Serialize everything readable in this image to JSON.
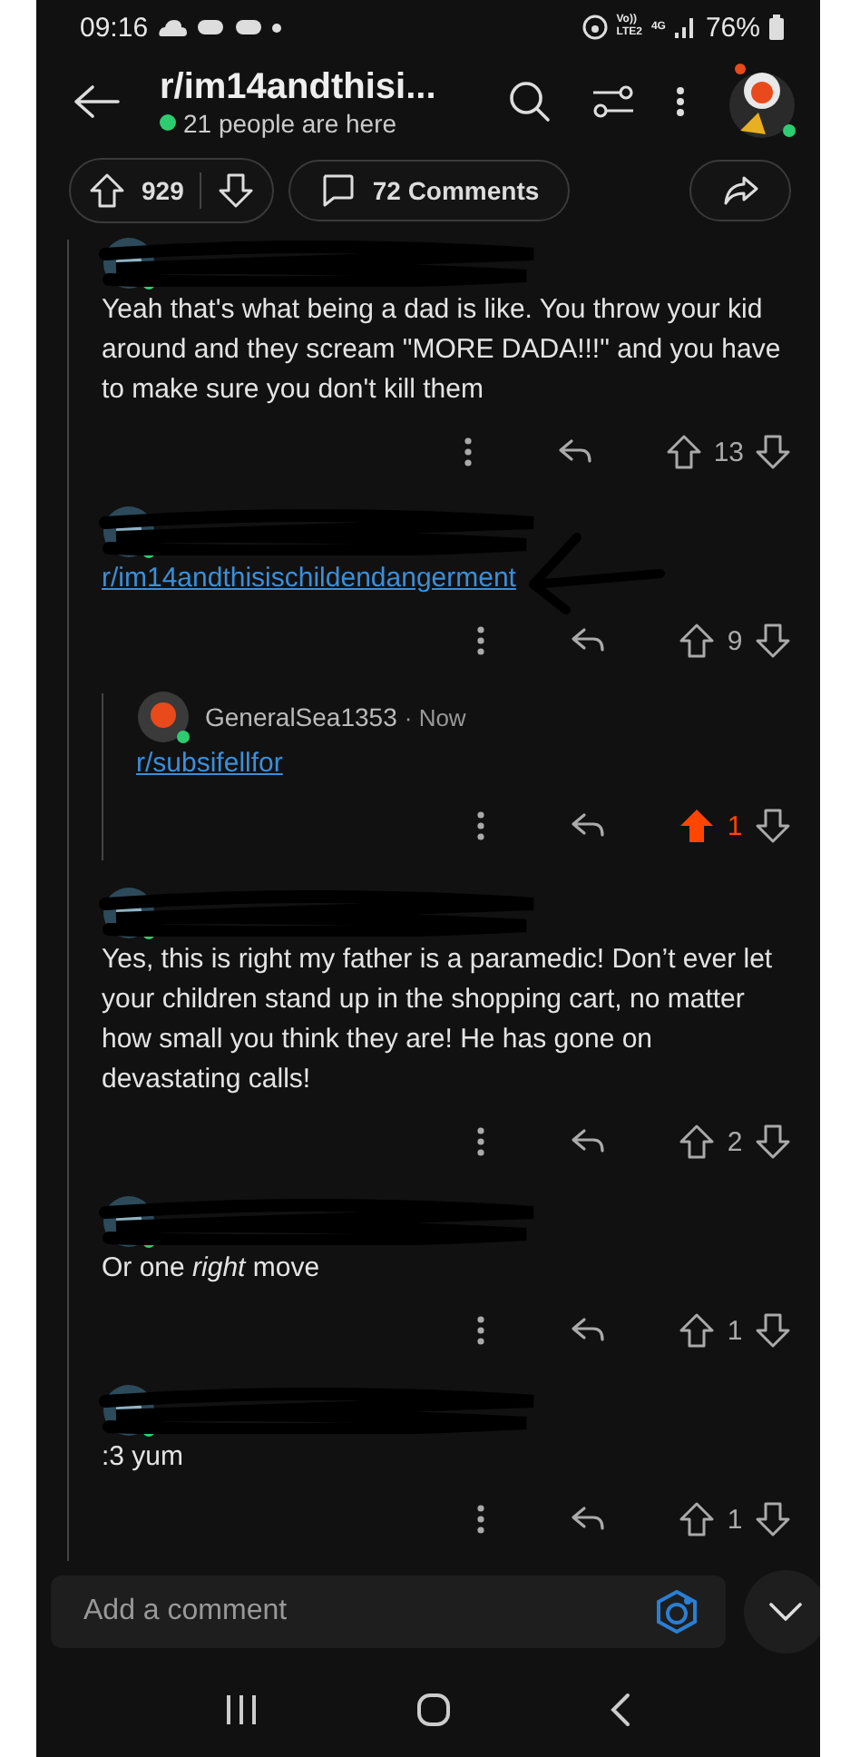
{
  "status_bar": {
    "time": "09:16",
    "volte": "Vo))",
    "lte": "LTE2",
    "network": "4G",
    "battery": "76%"
  },
  "header": {
    "title": "r/im14andthisi...",
    "subtitle": "21 people are here"
  },
  "post_bar": {
    "score": "929",
    "comments": "72 Comments"
  },
  "comments": [
    {
      "kind": "text",
      "body": "Yeah that's what being a dad is like. You throw your kid around and they scream \"MORE DADA!!!\" and you have to make sure you don't kill them",
      "score": "13",
      "upvoted": false,
      "marked": false
    },
    {
      "kind": "link",
      "body": "r/im14andthisischildendangerment",
      "score": "9",
      "upvoted": false,
      "marked": true,
      "children": [
        {
          "kind": "link",
          "author": "GeneralSea1353",
          "time": "· Now",
          "body": "r/subsifellfor",
          "score": "1",
          "upvoted": true,
          "marked": false
        }
      ]
    },
    {
      "kind": "text",
      "body": "Yes, this is right my father is a paramedic! Don’t ever let your children stand up in the shopping cart, no matter how small you think they are! He has gone on devastating calls!",
      "score": "2",
      "upvoted": false,
      "marked": false
    },
    {
      "kind": "text",
      "body": "Or one *right* move",
      "score": "1",
      "upvoted": false,
      "marked": false
    },
    {
      "kind": "text",
      "body": ":3 yum",
      "score": "1",
      "upvoted": false,
      "marked": false
    }
  ],
  "composer": {
    "placeholder": "Add a comment"
  }
}
